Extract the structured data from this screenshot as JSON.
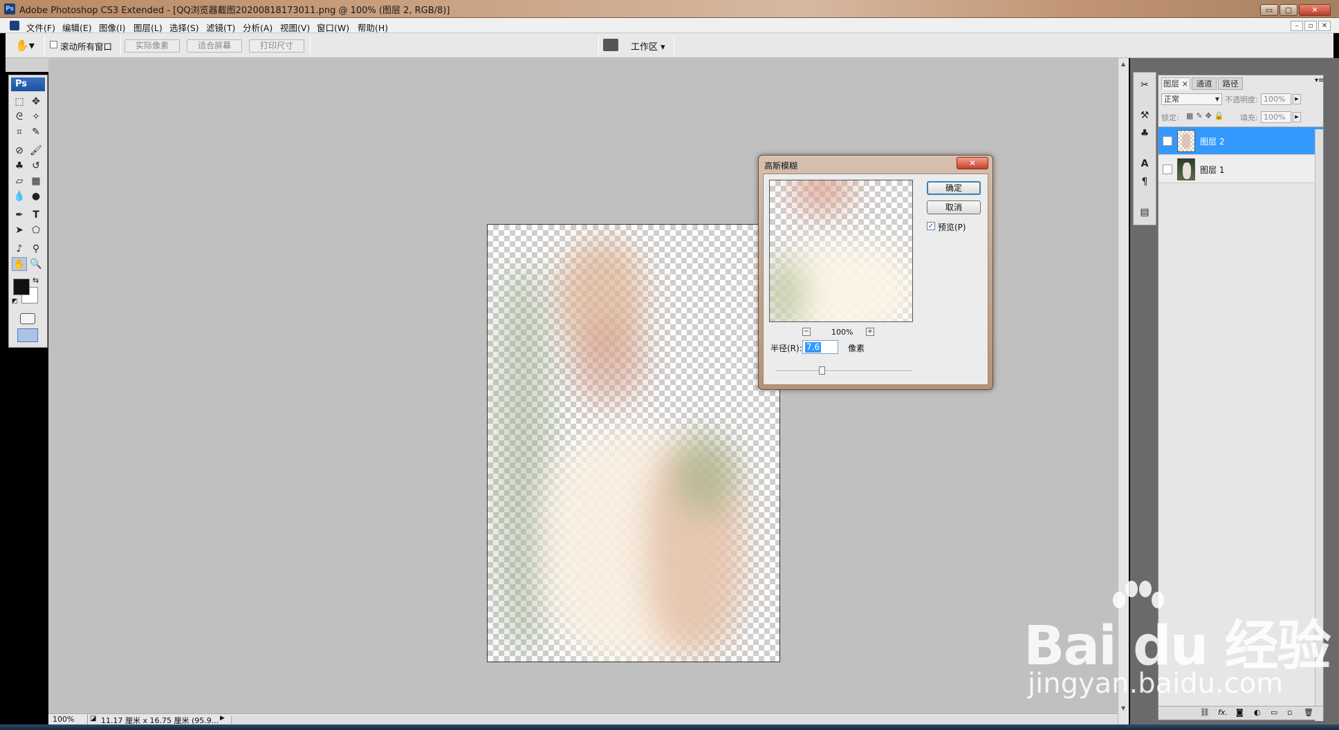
{
  "window": {
    "title": "Adobe Photoshop CS3 Extended - [QQ浏览器截图20200818173011.png @ 100% (图层 2, RGB/8)]",
    "app_icon_text": "Ps",
    "controls": {
      "minimize": "▭",
      "maximize": "▢",
      "close": "✕"
    }
  },
  "menu": {
    "items": [
      "文件(F)",
      "编辑(E)",
      "图像(I)",
      "图层(L)",
      "选择(S)",
      "滤镜(T)",
      "分析(A)",
      "视图(V)",
      "窗口(W)",
      "帮助(H)"
    ],
    "mdi_controls": {
      "minimize": "–",
      "restore": "▫",
      "close": "✕"
    }
  },
  "options_bar": {
    "scroll_all_label": "滚动所有窗口",
    "buttons": [
      "实际像素",
      "适合屏幕",
      "打印尺寸"
    ],
    "workspace_label": "工作区 ▾"
  },
  "toolbox": {
    "logo": "Ps",
    "tools": [
      {
        "name": "marquee-tool-icon",
        "glyph": "⬚"
      },
      {
        "name": "move-tool-icon",
        "glyph": "✥"
      },
      {
        "name": "lasso-tool-icon",
        "glyph": "ᘓ"
      },
      {
        "name": "magic-wand-tool-icon",
        "glyph": "✧"
      },
      {
        "name": "crop-tool-icon",
        "glyph": "⌗"
      },
      {
        "name": "slice-tool-icon",
        "glyph": "✎"
      },
      {
        "name": "healing-brush-tool-icon",
        "glyph": "⊘"
      },
      {
        "name": "brush-tool-icon",
        "glyph": "🖌"
      },
      {
        "name": "clone-stamp-tool-icon",
        "glyph": "♣"
      },
      {
        "name": "history-brush-tool-icon",
        "glyph": "↺"
      },
      {
        "name": "eraser-tool-icon",
        "glyph": "▱"
      },
      {
        "name": "gradient-tool-icon",
        "glyph": "▦"
      },
      {
        "name": "blur-tool-icon",
        "glyph": "💧"
      },
      {
        "name": "dodge-tool-icon",
        "glyph": "●"
      },
      {
        "name": "pen-tool-icon",
        "glyph": "✒"
      },
      {
        "name": "type-tool-icon",
        "glyph": "T"
      },
      {
        "name": "path-selection-tool-icon",
        "glyph": "➤"
      },
      {
        "name": "shape-tool-icon",
        "glyph": "⬠"
      },
      {
        "name": "notes-tool-icon",
        "glyph": "♪"
      },
      {
        "name": "eyedropper-tool-icon",
        "glyph": "⚲"
      },
      {
        "name": "hand-tool-icon",
        "glyph": "✋"
      },
      {
        "name": "zoom-tool-icon",
        "glyph": "🔍"
      }
    ],
    "foreground_color": "#111111",
    "background_color": "#ffffff"
  },
  "status_bar": {
    "zoom": "100%",
    "doc_info": "11.17 厘米 x 16.75 厘米 (95.9..."
  },
  "dialog": {
    "title": "高斯模糊",
    "ok_label": "确定",
    "cancel_label": "取消",
    "preview_label": "预览(P)",
    "preview_checked": true,
    "zoom_value": "100%",
    "radius_label": "半径(R):",
    "radius_value": "7.6",
    "radius_unit": "像素",
    "zoom_out": "−",
    "zoom_in": "+"
  },
  "layers_panel": {
    "tabs": [
      "图层",
      "通道",
      "路径"
    ],
    "active_tab": 0,
    "tab_close": "×",
    "blend_mode": "正常",
    "opacity_label": "不透明度:",
    "opacity_value": "100%",
    "lock_label": "锁定:",
    "fill_label": "填充:",
    "fill_value": "100%",
    "layers": [
      {
        "name": "图层 2",
        "selected": true,
        "visible": true
      },
      {
        "name": "图层 1",
        "selected": false,
        "visible": false
      }
    ],
    "bottom_icons": [
      "link-layers-icon",
      "fx-icon",
      "mask-icon",
      "adjustment-layer-icon",
      "group-icon",
      "new-layer-icon",
      "trash-icon"
    ],
    "bottom_glyphs": [
      "⛓",
      "fx.",
      "◙",
      "◐",
      "▭",
      "▫",
      "🗑"
    ]
  },
  "watermark": {
    "logo": "Bai du 经验",
    "url": "jingyan.baidu.com"
  }
}
